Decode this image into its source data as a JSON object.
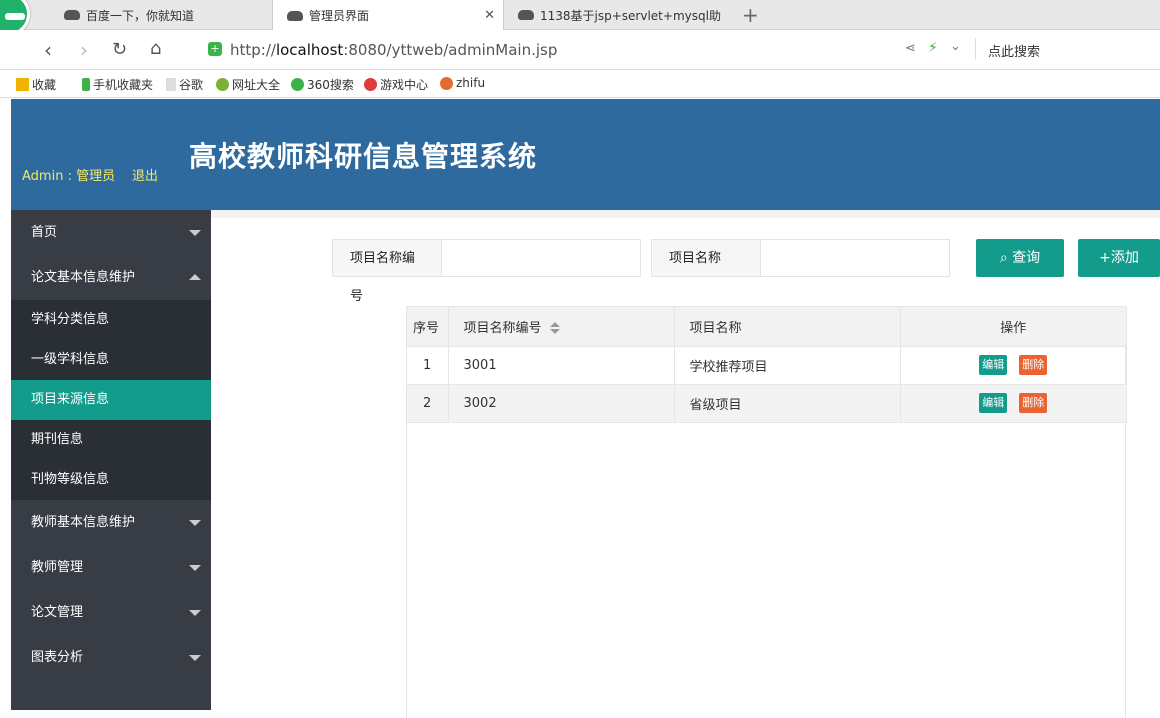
{
  "browser": {
    "tabs": [
      {
        "label": "百度一下，你就知道"
      },
      {
        "label": "管理员界面"
      },
      {
        "label": "1138基于jsp+servlet+mysql助"
      }
    ],
    "url_prefix": "http://",
    "url_host": "localhost",
    "url_rest": ":8080/yttweb/adminMain.jsp",
    "search_hint": "点此搜索",
    "bookmarks": [
      "收藏",
      "手机收藏夹",
      "谷歌",
      "网址大全",
      "360搜索",
      "游戏中心",
      "zhifu"
    ]
  },
  "header": {
    "admin_label": "Admin : 管理员",
    "logout_label": "退出",
    "system_title": "高校教师科研信息管理系统"
  },
  "sidebar": {
    "menus": [
      {
        "label": "首页"
      },
      {
        "label": "论文基本信息维护",
        "expanded": true,
        "items": [
          {
            "label": "学科分类信息"
          },
          {
            "label": "一级学科信息"
          },
          {
            "label": "项目来源信息",
            "active": true
          },
          {
            "label": "期刊信息"
          },
          {
            "label": "刊物等级信息"
          }
        ]
      },
      {
        "label": "教师基本信息维护"
      },
      {
        "label": "教师管理"
      },
      {
        "label": "论文管理"
      },
      {
        "label": "图表分析"
      }
    ]
  },
  "search": {
    "field1_label": "项目名称编号",
    "field2_label": "项目名称",
    "query_button": "查询",
    "add_button": "+添加"
  },
  "table": {
    "headers": [
      "序号",
      "项目名称编号",
      "项目名称",
      "操作"
    ],
    "rows": [
      {
        "no": "1",
        "code": "3001",
        "name": "学校推荐项目"
      },
      {
        "no": "2",
        "code": "3002",
        "name": "省级项目"
      }
    ],
    "edit_label": "编辑",
    "delete_label": "删除"
  },
  "colors": {
    "header_bg": "#2f6a9e",
    "sidebar_bg": "#373c45",
    "accent": "#139c8c",
    "delete": "#ea6432"
  }
}
